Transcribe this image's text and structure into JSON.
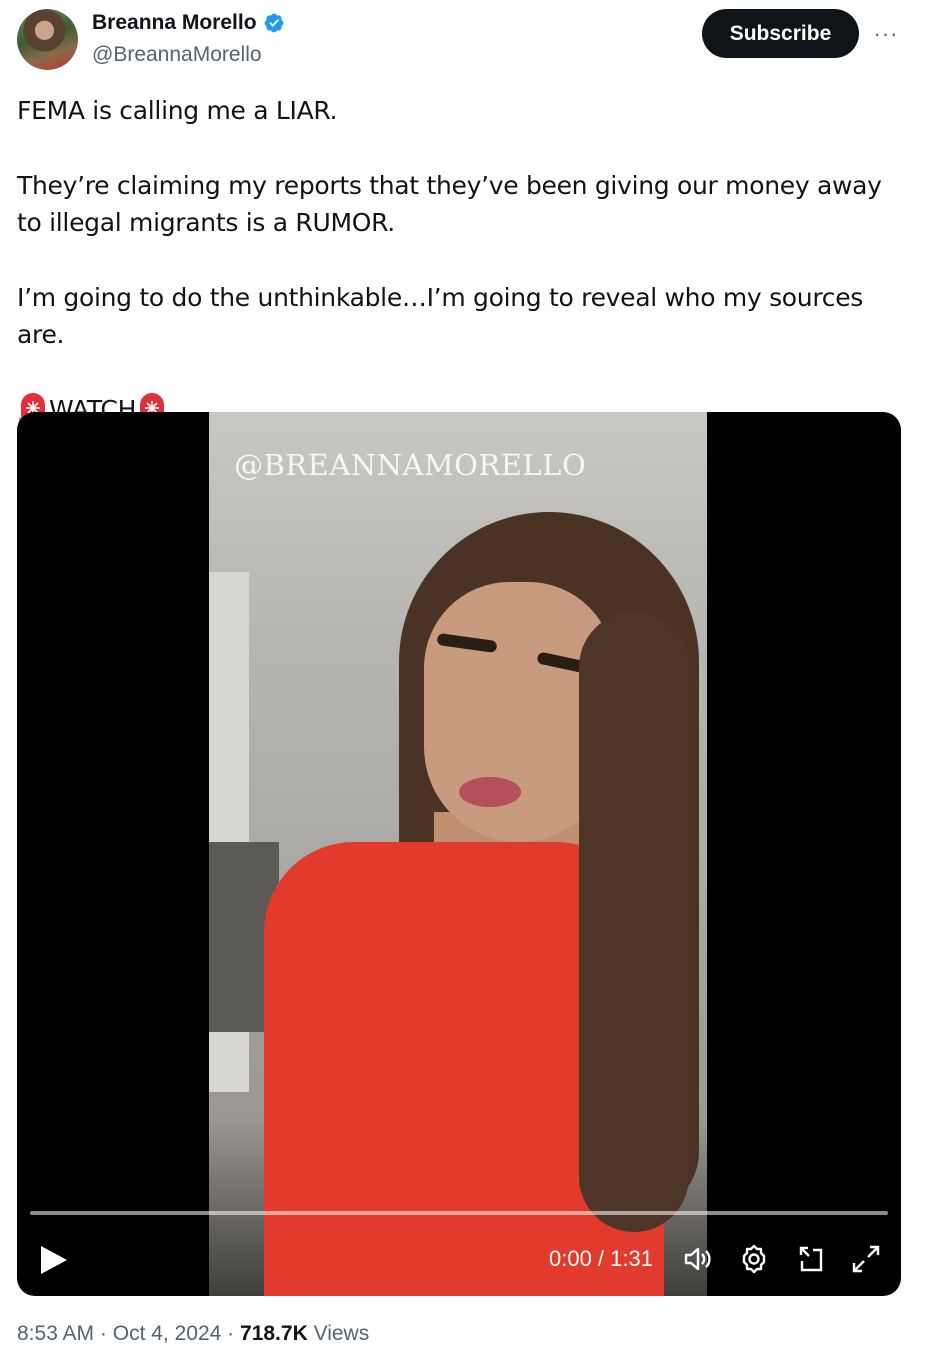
{
  "author": {
    "name": "Breanna Morello",
    "handle": "@BreannaMorello",
    "verified_color": "#1d9bf0"
  },
  "actions": {
    "subscribe_label": "Subscribe",
    "more_label": "···"
  },
  "tweet": {
    "line1": "FEMA is calling me a LIAR.",
    "line2": "They’re claiming my reports that they’ve been giving our money away to illegal migrants is a RUMOR.",
    "line3": "I’m going to do the unthinkable…I’m going to reveal who my sources are.",
    "line4_text": "WATCH",
    "line4_emoji": "siren-icon"
  },
  "video": {
    "watermark": "@BREANNAMORELLO",
    "time": "0:00 / 1:31",
    "progress": 0
  },
  "meta": {
    "time": "8:53 AM",
    "separator": "·",
    "date": "Oct 4, 2024",
    "views_count": "718.7K",
    "views_label": "Views"
  },
  "colors": {
    "text": "#0f1419",
    "secondary": "#536471",
    "button": "#0f1419"
  }
}
